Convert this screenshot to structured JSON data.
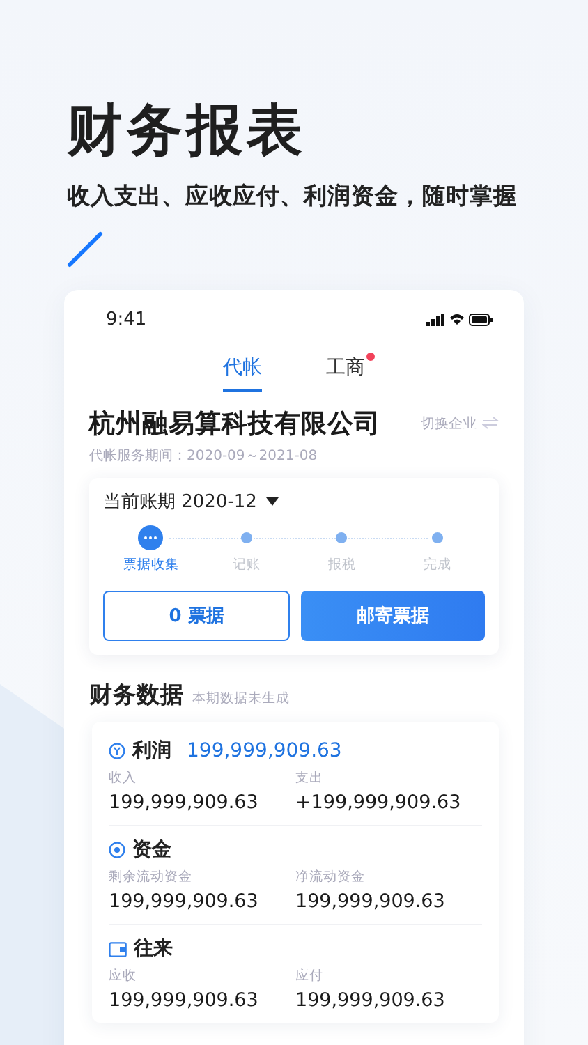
{
  "headline": {
    "title": "财务报表",
    "subtitle": "收入支出、应收应付、利润资金，随时掌握"
  },
  "status_bar": {
    "time": "9:41"
  },
  "tabs": [
    {
      "label": "代帐",
      "selected": true,
      "badge": false
    },
    {
      "label": "工商",
      "selected": false,
      "badge": true
    }
  ],
  "company": {
    "name": "杭州融易算科技有限公司",
    "switch_label": "切换企业",
    "service_period": "代帐服务期间：2020-09～2021-08"
  },
  "period_card": {
    "label": "当前账期 2020-12",
    "steps": [
      {
        "label": "票据收集",
        "selected": true
      },
      {
        "label": "记账",
        "selected": false
      },
      {
        "label": "报税",
        "selected": false
      },
      {
        "label": "完成",
        "selected": false
      }
    ],
    "buttons": [
      {
        "label": "0 票据",
        "kind": "outline"
      },
      {
        "label": "邮寄票据",
        "kind": "primary"
      }
    ]
  },
  "finance": {
    "title": "财务数据",
    "note": "本期数据未生成",
    "sections": [
      {
        "kind": "profit",
        "title": "利润",
        "total": "199,999,909.63",
        "items": [
          {
            "label": "收入",
            "value": "199,999,909.63"
          },
          {
            "label": "支出",
            "value": "+199,999,909.63"
          }
        ]
      },
      {
        "kind": "funds",
        "title": "资金",
        "items": [
          {
            "label": "剩余流动资金",
            "value": "199,999,909.63"
          },
          {
            "label": "净流动资金",
            "value": "199,999,909.63"
          }
        ]
      },
      {
        "kind": "accounts",
        "title": "往来",
        "items": [
          {
            "label": "应收",
            "value": "199,999,909.63"
          },
          {
            "label": "应付",
            "value": "199,999,909.63"
          }
        ]
      }
    ]
  }
}
